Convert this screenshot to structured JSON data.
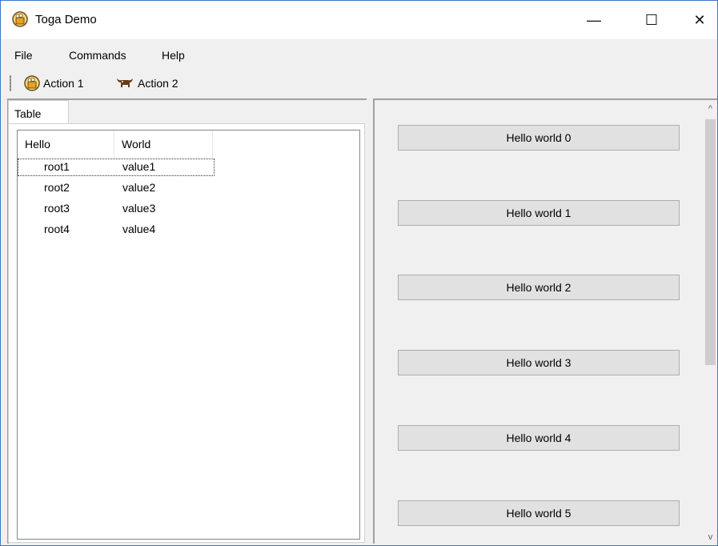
{
  "window": {
    "title": "Toga Demo",
    "controls": {
      "minimize": "—",
      "maximize": "☐",
      "close": "✕"
    }
  },
  "menubar": {
    "items": [
      "File",
      "Commands",
      "Help"
    ]
  },
  "toolbar": {
    "items": [
      {
        "label": "Action 1",
        "icon": "beer-icon"
      },
      {
        "label": "Action 2",
        "icon": "bull-icon"
      }
    ]
  },
  "tabs": {
    "active": "Table"
  },
  "table": {
    "headers": [
      "Hello",
      "World"
    ],
    "rows": [
      {
        "hello": "root1",
        "world": "value1"
      },
      {
        "hello": "root2",
        "world": "value2"
      },
      {
        "hello": "root3",
        "world": "value3"
      },
      {
        "hello": "root4",
        "world": "value4"
      }
    ]
  },
  "buttons": [
    "Hello world 0",
    "Hello world 1",
    "Hello world 2",
    "Hello world 3",
    "Hello world 4",
    "Hello world 5"
  ],
  "scroll_arrows": {
    "up": "^",
    "down": "v"
  }
}
